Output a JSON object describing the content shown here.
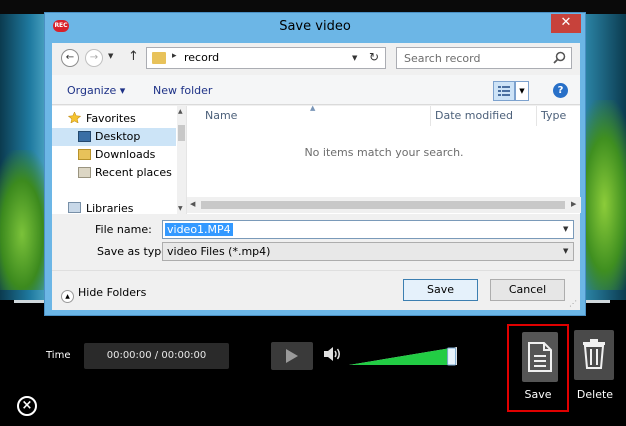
{
  "dialog": {
    "title": "Save video",
    "app_icon_text": "REC",
    "close_glyph": "✕",
    "address": {
      "folder": "record",
      "separator": "▸"
    },
    "search_placeholder": "Search record",
    "toolbar": {
      "organize": "Organize ▾",
      "new_folder": "New folder",
      "help": "?"
    },
    "nav": {
      "favorites": "Favorites",
      "items": [
        {
          "label": "Desktop",
          "icon": "desktop-icon"
        },
        {
          "label": "Downloads",
          "icon": "downloads-folder-icon"
        },
        {
          "label": "Recent places",
          "icon": "recent-places-icon"
        }
      ],
      "libraries": "Libraries"
    },
    "columns": {
      "name": "Name",
      "date_modified": "Date modified",
      "type": "Type"
    },
    "empty_message": "No items match your search.",
    "file_name_label": "File name:",
    "file_name_value": "video1.MP4",
    "save_as_type_label": "Save as type:",
    "save_as_type_value": "video Files (*.mp4)",
    "hide_folders": "Hide Folders",
    "save_button": "Save",
    "cancel_button": "Cancel"
  },
  "player": {
    "time_label": "Time",
    "time_value": "00:00:00 / 00:00:00",
    "save_label": "Save",
    "delete_label": "Delete",
    "volume_level": 0.95
  },
  "colors": {
    "highlight": "#e00000",
    "volume": "#22cc44",
    "dialog_frame": "#6cb6e6"
  }
}
